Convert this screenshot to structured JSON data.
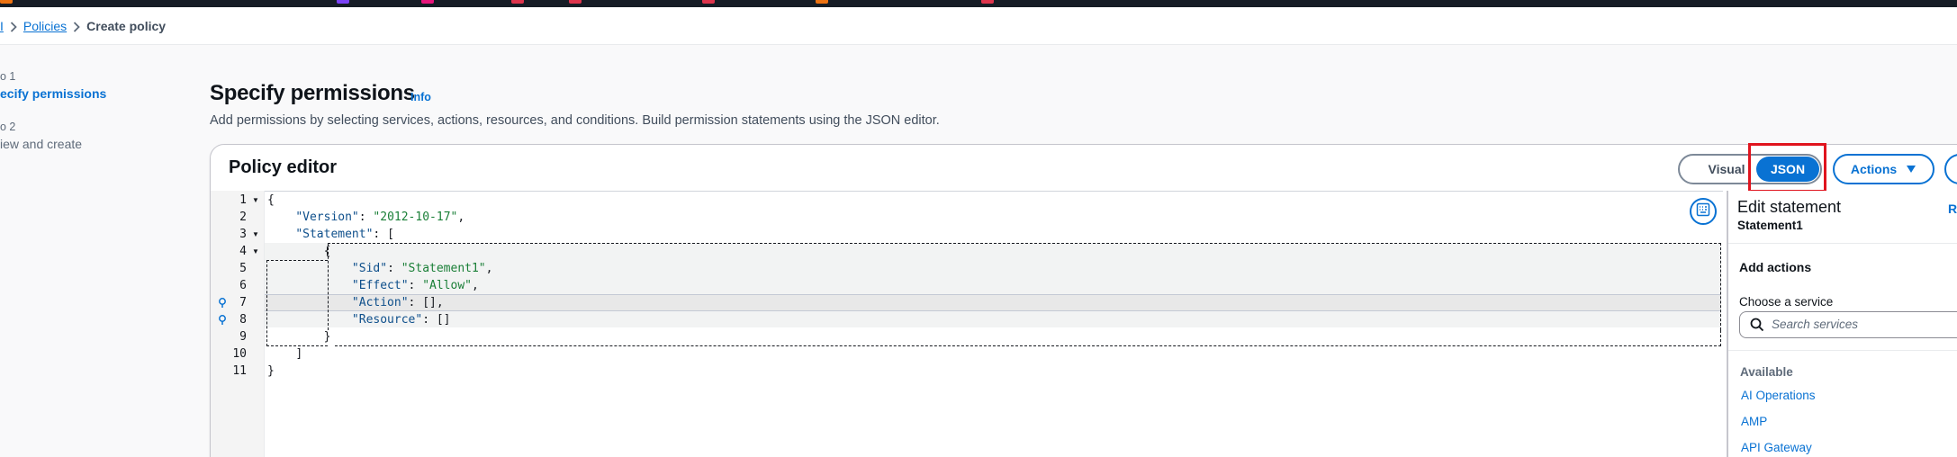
{
  "breadcrumb": {
    "root_partial": "I",
    "policies": "Policies",
    "current": "Create policy"
  },
  "steps": [
    {
      "num": "o 1",
      "label": "ecify permissions",
      "active": true
    },
    {
      "num": "o 2",
      "label": "iew and create",
      "active": false
    }
  ],
  "header": {
    "title": "Specify permissions",
    "info": "Info",
    "description": "Add permissions by selecting services, actions, resources, and conditions. Build permission statements using the JSON editor."
  },
  "editor_panel": {
    "title": "Policy editor",
    "mode_visual": "Visual",
    "mode_json": "JSON",
    "selected_mode": "JSON",
    "actions_label": "Actions"
  },
  "code": {
    "line_numbers": [
      "1",
      "2",
      "3",
      "4",
      "5",
      "6",
      "7",
      "8",
      "9",
      "10",
      "11"
    ],
    "lines": [
      {
        "indent": "",
        "key": "",
        "sep": "",
        "value": "",
        "tail": "{"
      },
      {
        "indent": "    ",
        "key": "\"Version\"",
        "sep": ": ",
        "value": "\"2012-10-17\"",
        "tail": ","
      },
      {
        "indent": "    ",
        "key": "\"Statement\"",
        "sep": ": ",
        "value": "",
        "tail": "["
      },
      {
        "indent": "        ",
        "key": "",
        "sep": "",
        "value": "",
        "tail": "{"
      },
      {
        "indent": "            ",
        "key": "\"Sid\"",
        "sep": ": ",
        "value": "\"Statement1\"",
        "tail": ","
      },
      {
        "indent": "            ",
        "key": "\"Effect\"",
        "sep": ": ",
        "value": "\"Allow\"",
        "tail": ","
      },
      {
        "indent": "            ",
        "key": "\"Action\"",
        "sep": ": ",
        "value": "",
        "tail": "[],"
      },
      {
        "indent": "            ",
        "key": "\"Resource\"",
        "sep": ": ",
        "value": "",
        "tail": "[]"
      },
      {
        "indent": "        ",
        "key": "",
        "sep": "",
        "value": "",
        "tail": "}"
      },
      {
        "indent": "    ",
        "key": "",
        "sep": "",
        "value": "",
        "tail": "]"
      },
      {
        "indent": "",
        "key": "",
        "sep": "",
        "value": "",
        "tail": "}"
      }
    ]
  },
  "right_panel": {
    "title": "Edit statement",
    "subtitle": "Statement1",
    "corner_partial": "R",
    "add_actions": "Add actions",
    "choose_service": "Choose a service",
    "search_placeholder": "Search services",
    "available_label": "Available",
    "services": [
      "AI Operations",
      "AMP",
      "API Gateway"
    ]
  },
  "colors": {
    "accent": "#0972d3",
    "highlight": "#e0141e",
    "topbar": "#161d26"
  },
  "icons": [
    "chevron-right-icon",
    "caret-down-icon",
    "keyboard-icon",
    "search-icon",
    "lightbulb-icon"
  ]
}
